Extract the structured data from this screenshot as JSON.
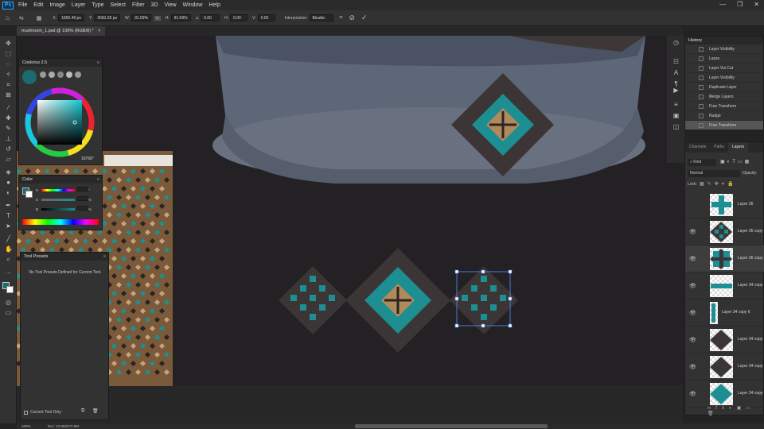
{
  "app": {
    "logo": "Ps",
    "menu": [
      "File",
      "Edit",
      "Image",
      "Layer",
      "Type",
      "Select",
      "Filter",
      "3D",
      "View",
      "Window",
      "Help"
    ],
    "window_controls": [
      "—",
      "❐",
      "✕"
    ]
  },
  "options_bar": {
    "x_label": "X:",
    "x_value": "1650.49 px",
    "y_label": "Y:",
    "y_value": "2681.05 px",
    "w_label": "W:",
    "w_value": "91.59%",
    "h_label": "H:",
    "h_value": "91.59%",
    "angle_value": "0.00",
    "hskew_label": "H:",
    "hskew_value": "0.00",
    "vskew_label": "V:",
    "vskew_value": "0.00",
    "interpolation_label": "Interpolation:",
    "interpolation_value": "Bicubic",
    "cancel_icon": "cancel-icon",
    "commit_icon": "check-icon"
  },
  "document": {
    "tab_title": "mushroom_1.psd @ 100% (RGB/8) *",
    "tab_close": "×"
  },
  "coolorus": {
    "title": "Coolorus 2.5",
    "hex_value": "19766*",
    "primary_color": "#1c6b6f"
  },
  "color_panel": {
    "title": "Color",
    "channels": [
      "H",
      "S",
      "B"
    ],
    "values": [
      "",
      "",
      ""
    ],
    "units": [
      "°",
      "%",
      "%"
    ]
  },
  "tool_presets": {
    "title": "Tool Presets",
    "empty_message": "No Tool Presets Defined for Current Tool.",
    "checkbox_label": "Current Tool Only"
  },
  "history": {
    "title": "History",
    "items": [
      "Layer Visibility",
      "Lasso",
      "Layer Via Cut",
      "Layer Visibility",
      "Duplicate Layer",
      "Merge Layers",
      "Free Transform",
      "Nudge",
      "Free Transform"
    ]
  },
  "layers": {
    "tabs": [
      "Channels",
      "Paths",
      "Layers"
    ],
    "kind_label": "Kind",
    "blend_mode": "Normal",
    "opacity_label": "Opacity:",
    "lock_label": "Lock:",
    "rows": [
      {
        "name": "Layer 36",
        "visible": false
      },
      {
        "name": "Layer 36 copy",
        "visible": true
      },
      {
        "name": "Layer 36 copy",
        "visible": true
      },
      {
        "name": "Layer 34 copy",
        "visible": true
      },
      {
        "name": "Layer 34 copy 6",
        "visible": true
      },
      {
        "name": "Layer 34 copy",
        "visible": true
      },
      {
        "name": "Layer 34 copy",
        "visible": true
      },
      {
        "name": "Layer 34 copy",
        "visible": true
      }
    ]
  },
  "status": {
    "zoom": "100%",
    "doc_size": "Doc: 23.9M/272.9M"
  },
  "colors": {
    "teal": "#1d8e92",
    "dark_diamond": "#3b3535",
    "bronze": "#b08a5a",
    "hat": "#6a7383",
    "selection": "#4a7bd8"
  }
}
